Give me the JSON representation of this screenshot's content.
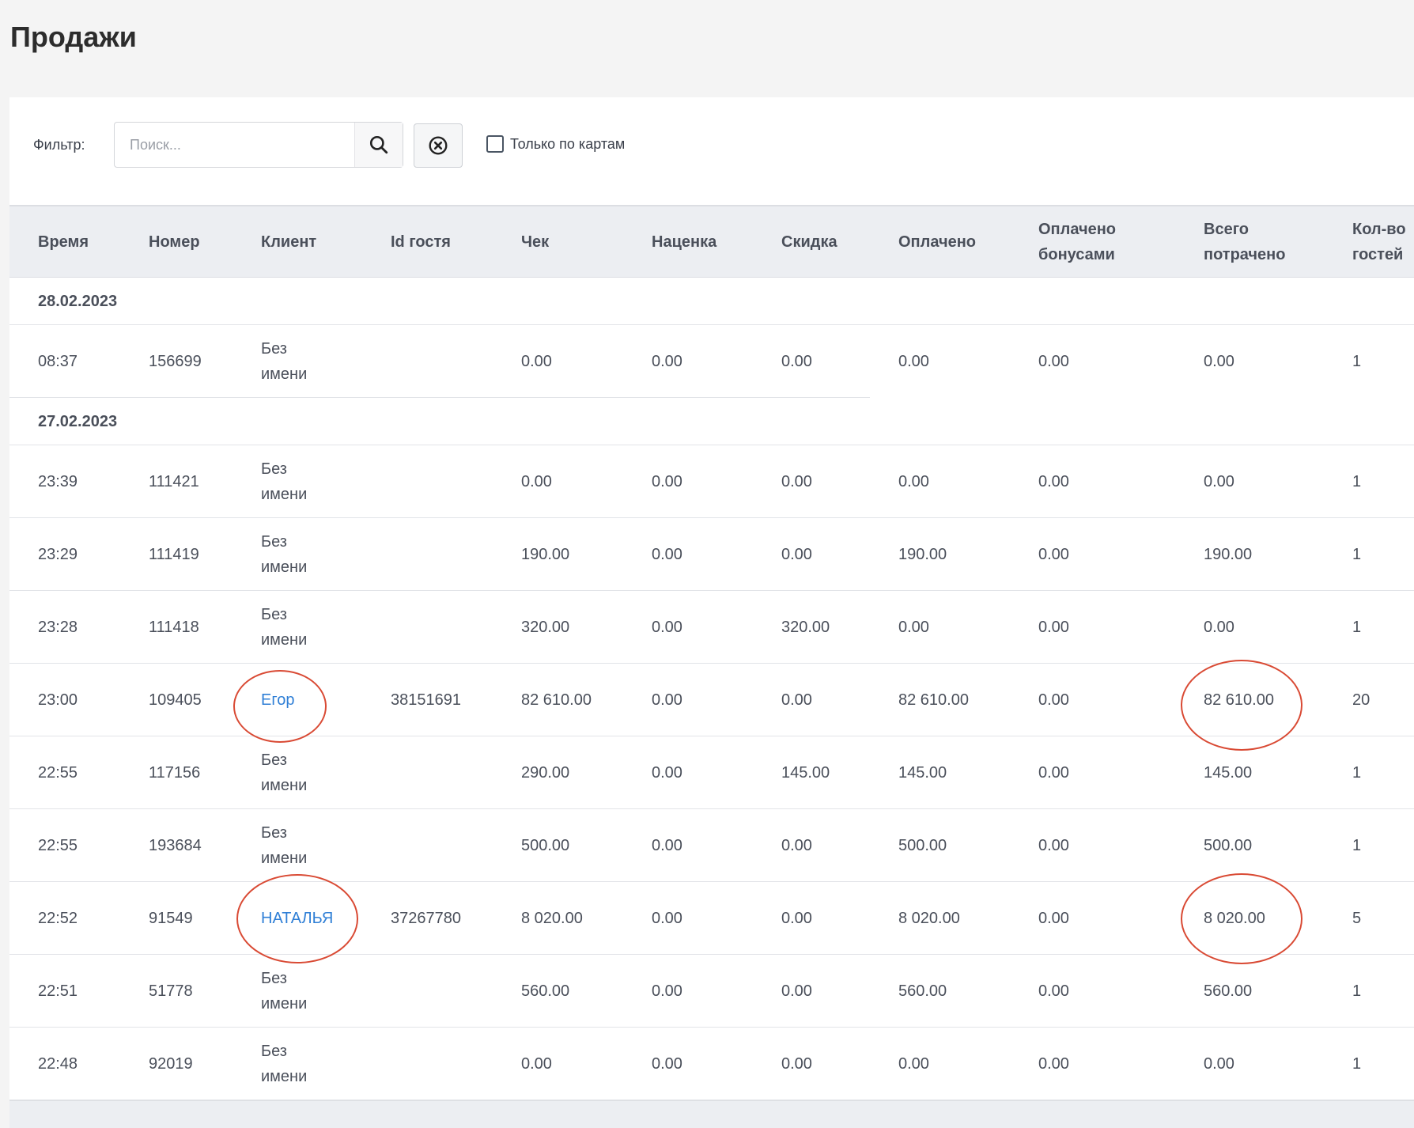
{
  "page": {
    "title": "Продажи"
  },
  "filter": {
    "label": "Фильтр:",
    "search_placeholder": "Поиск...",
    "cards_only_label": "Только по картам"
  },
  "table": {
    "headers": [
      "Время",
      "Номер",
      "Клиент",
      "Id гостя",
      "Чек",
      "Наценка",
      "Скидка",
      "Оплачено",
      "Оплачено бонусами",
      "Всего потрачено",
      "Кол-во гостей"
    ],
    "groups": [
      {
        "date": "28.02.2023",
        "rows": [
          {
            "time": "08:37",
            "number": "156699",
            "client": "Без имени",
            "guest_id": "",
            "check": "0.00",
            "markup": "0.00",
            "discount": "0.00",
            "paid": "0.00",
            "paid_bonus": "0.00",
            "total": "0.00",
            "guests": "1"
          }
        ]
      },
      {
        "date": "27.02.2023",
        "rows": [
          {
            "time": "23:39",
            "number": "111421",
            "client": "Без имени",
            "guest_id": "",
            "check": "0.00",
            "markup": "0.00",
            "discount": "0.00",
            "paid": "0.00",
            "paid_bonus": "0.00",
            "total": "0.00",
            "guests": "1"
          },
          {
            "time": "23:29",
            "number": "111419",
            "client": "Без имени",
            "guest_id": "",
            "check": "190.00",
            "markup": "0.00",
            "discount": "0.00",
            "paid": "190.00",
            "paid_bonus": "0.00",
            "total": "190.00",
            "guests": "1"
          },
          {
            "time": "23:28",
            "number": "111418",
            "client": "Без имени",
            "guest_id": "",
            "check": "320.00",
            "markup": "0.00",
            "discount": "320.00",
            "paid": "0.00",
            "paid_bonus": "0.00",
            "total": "0.00",
            "guests": "1"
          },
          {
            "time": "23:00",
            "number": "109405",
            "client": "Егор",
            "guest_id": "38151691",
            "check": "82 610.00",
            "markup": "0.00",
            "discount": "0.00",
            "paid": "82 610.00",
            "paid_bonus": "0.00",
            "total": "82 610.00",
            "guests": "20"
          },
          {
            "time": "22:55",
            "number": "117156",
            "client": "Без имени",
            "guest_id": "",
            "check": "290.00",
            "markup": "0.00",
            "discount": "145.00",
            "paid": "145.00",
            "paid_bonus": "0.00",
            "total": "145.00",
            "guests": "1"
          },
          {
            "time": "22:55",
            "number": "193684",
            "client": "Без имени",
            "guest_id": "",
            "check": "500.00",
            "markup": "0.00",
            "discount": "0.00",
            "paid": "500.00",
            "paid_bonus": "0.00",
            "total": "500.00",
            "guests": "1"
          },
          {
            "time": "22:52",
            "number": "91549",
            "client": "НАТАЛЬЯ",
            "guest_id": "37267780",
            "check": "8 020.00",
            "markup": "0.00",
            "discount": "0.00",
            "paid": "8 020.00",
            "paid_bonus": "0.00",
            "total": "8 020.00",
            "guests": "5"
          },
          {
            "time": "22:51",
            "number": "51778",
            "client": "Без имени",
            "guest_id": "",
            "check": "560.00",
            "markup": "0.00",
            "discount": "0.00",
            "paid": "560.00",
            "paid_bonus": "0.00",
            "total": "560.00",
            "guests": "1"
          },
          {
            "time": "22:48",
            "number": "92019",
            "client": "Без имени",
            "guest_id": "",
            "check": "0.00",
            "markup": "0.00",
            "discount": "0.00",
            "paid": "0.00",
            "paid_bonus": "0.00",
            "total": "0.00",
            "guests": "1"
          }
        ]
      }
    ]
  },
  "colors": {
    "link": "#2f7fd6",
    "annotation": "#d94a34",
    "header_bg": "#eceef2"
  }
}
